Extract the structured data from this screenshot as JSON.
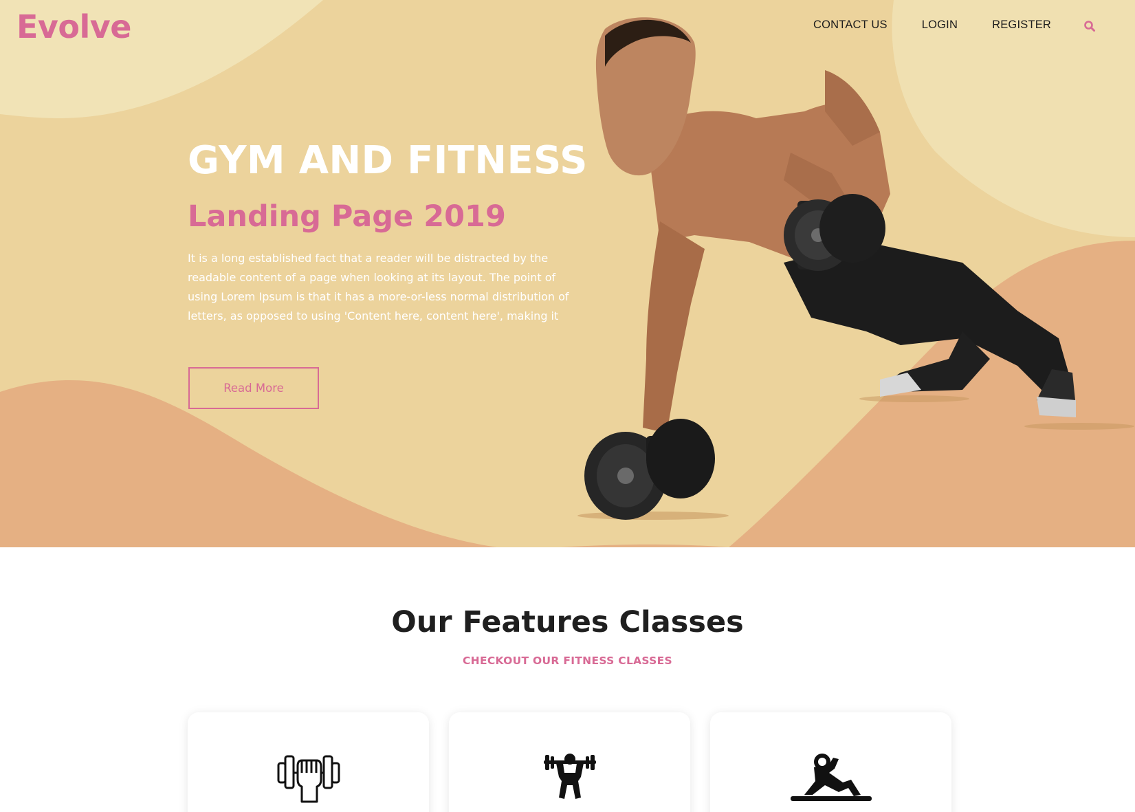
{
  "brand": {
    "name": "Evolve",
    "accent": "#d86a95"
  },
  "nav": {
    "items": [
      {
        "label": "CONTACT US"
      },
      {
        "label": "LOGIN"
      },
      {
        "label": "REGISTER"
      }
    ],
    "search_icon": "search-icon"
  },
  "hero": {
    "title": "GYM AND FITNESS",
    "subtitle": "Landing Page 2019",
    "body": "It is a long established fact that a reader will be distracted by the readable content of a page when looking at its layout. The point of using Lorem Ipsum is that it has a more-or-less normal distribution of letters, as opposed to using 'Content here, content here', making it",
    "cta_label": "Read More",
    "image": "athlete-doing-dumbbell-push-up"
  },
  "features": {
    "title": "Our Features Classes",
    "subtitle": "CHECKOUT OUR FITNESS CLASSES",
    "cards": [
      {
        "icon": "fist-dumbbell-icon"
      },
      {
        "icon": "weightlifter-icon"
      },
      {
        "icon": "situp-icon"
      }
    ]
  },
  "colors": {
    "hero_light": "#f1e2b4",
    "hero_mid": "#ecd39c",
    "hero_dark": "#e6b080",
    "text_dark": "#1f1f1f"
  }
}
